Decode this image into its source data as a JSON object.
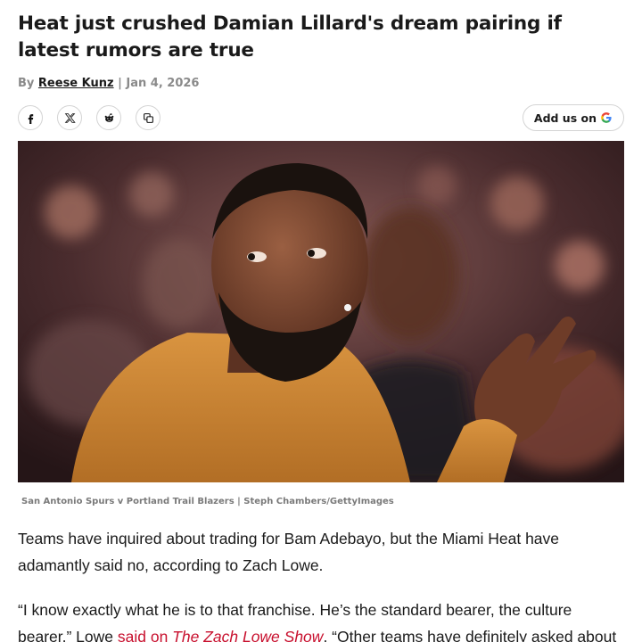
{
  "article": {
    "headline": "Heat just crushed Damian Lillard's dream pairing if latest rumors are true",
    "byline_prefix": "By ",
    "author": "Reese Kunz",
    "byline_sep": " | ",
    "date": "Jan 4, 2026"
  },
  "share": {
    "icons": [
      "facebook-icon",
      "x-icon",
      "reddit-icon",
      "copy-link-icon"
    ],
    "add_us_label": "Add us on",
    "add_us_icon": "google-icon"
  },
  "hero": {
    "caption": "San Antonio Spurs v Portland Trail Blazers | Steph Chambers/GettyImages"
  },
  "body": {
    "p1": "Teams have inquired about trading for Bam Adebayo, but the Miami Heat have adamantly said no, according to Zach Lowe.",
    "p2_start": "“I know exactly what he is to that franchise. He’s the standard bearer, the culture bearer,” Lowe ",
    "p2_link1": "said on ",
    "p2_link2": "The Zach Lowe Show",
    "p2_end": ". “Other teams have definitely asked about"
  },
  "colors": {
    "link": "#c8102e",
    "text": "#1a1a1a",
    "muted": "#8a8a8a"
  }
}
